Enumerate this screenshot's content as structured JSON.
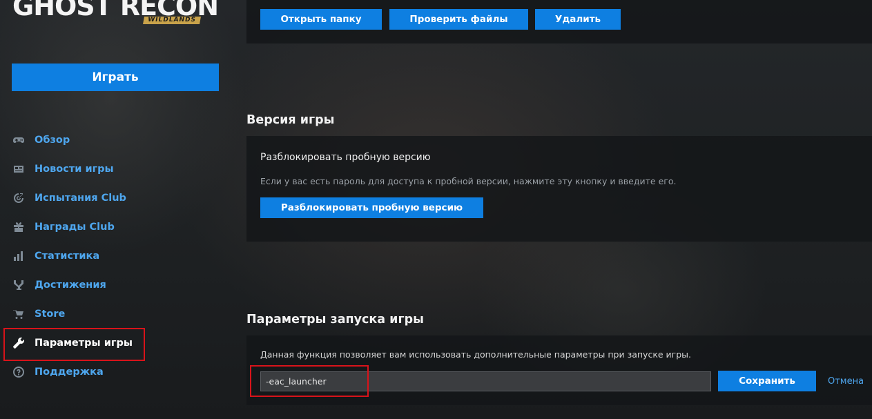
{
  "app": {
    "logo_main": "GHOST RECON",
    "logo_sub": "WILDLANDS"
  },
  "sidebar": {
    "play_label": "Играть",
    "items": [
      {
        "label": "Обзор",
        "icon": "gamepad-icon"
      },
      {
        "label": "Новости игры",
        "icon": "newspaper-icon"
      },
      {
        "label": "Испытания Club",
        "icon": "target-icon"
      },
      {
        "label": "Награды Club",
        "icon": "gift-icon"
      },
      {
        "label": "Статистика",
        "icon": "bar-chart-icon"
      },
      {
        "label": "Достижения",
        "icon": "trophy-icon"
      },
      {
        "label": "Store",
        "icon": "cart-icon"
      },
      {
        "label": "Параметры игры",
        "icon": "wrench-icon",
        "active": true
      },
      {
        "label": "Поддержка",
        "icon": "help-circle-icon"
      }
    ]
  },
  "files": {
    "open_folder": "Открыть папку",
    "verify_files": "Проверить файлы",
    "delete": "Удалить"
  },
  "version": {
    "title": "Версия игры",
    "heading": "Разблокировать пробную версию",
    "description": "Если у вас есть пароль для доступа к пробной версии, нажмите эту кнопку и введите его.",
    "button": "Разблокировать пробную версию"
  },
  "launch": {
    "title": "Параметры запуска игры",
    "description": "Данная функция позволяет вам использовать дополнительные параметры при запуске игры.",
    "value": "-eac_launcher",
    "save": "Сохранить",
    "cancel": "Отмена"
  },
  "colors": {
    "accent": "#0e7fe1",
    "link": "#4ea6ee",
    "highlight": "#d8131a"
  }
}
